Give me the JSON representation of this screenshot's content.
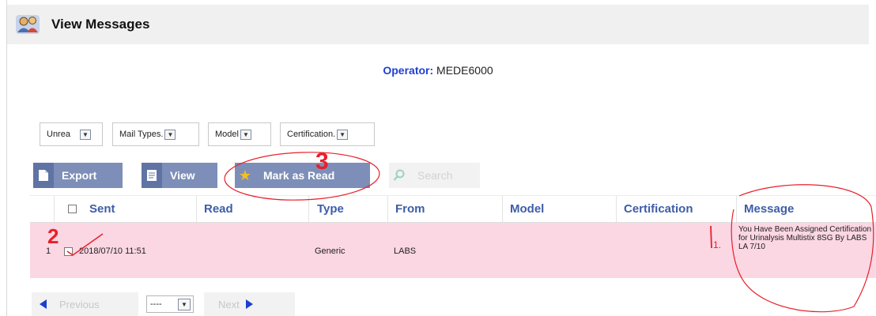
{
  "header": {
    "title": "View Messages",
    "icon": "people-icon"
  },
  "operator": {
    "label": "Operator:",
    "value": "MEDE6000"
  },
  "filters": [
    {
      "label": "Unrea"
    },
    {
      "label": "Mail Types."
    },
    {
      "label": "Model"
    },
    {
      "label": "Certification."
    }
  ],
  "toolbar": {
    "export_label": "Export",
    "view_label": "View",
    "mark_read_label": "Mark as Read",
    "search_label": "Search"
  },
  "table": {
    "columns": [
      "Sent",
      "Read",
      "Type",
      "From",
      "Model",
      "Certification",
      "Message"
    ],
    "rows": [
      {
        "index": "1",
        "sent": "2018/07/10 11:51",
        "read": "",
        "type": "Generic",
        "from": "LABS",
        "model": "",
        "certification": "",
        "message": "You Have Been Assigned Certification for Urinalysis Multistix 8SG By LABS LA 7/10"
      }
    ]
  },
  "pager": {
    "previous_label": "Previous",
    "page_value": "----",
    "next_label": "Next"
  },
  "annotations": {
    "mark_1": "1.",
    "mark_2": "2",
    "mark_3": "3",
    "ink_color": "#e8202a"
  },
  "colors": {
    "accent_blue": "#3e5da8",
    "button_blue": "#7d8fb8",
    "row_highlight": "#fbd6e3",
    "operator_label": "#1f3fd3"
  }
}
